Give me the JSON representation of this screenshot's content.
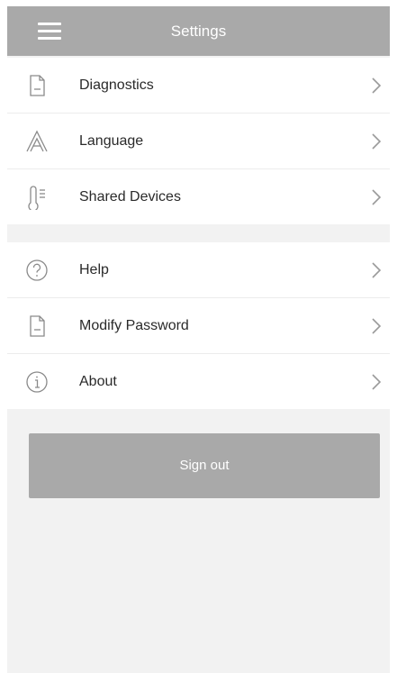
{
  "header": {
    "title": "Settings"
  },
  "sections": [
    {
      "items": [
        {
          "label": "Diagnostics",
          "icon": "document-icon"
        },
        {
          "label": "Language",
          "icon": "font-a-icon"
        },
        {
          "label": "Shared Devices",
          "icon": "thermometer-icon"
        }
      ]
    },
    {
      "items": [
        {
          "label": "Help",
          "icon": "help-circle-icon"
        },
        {
          "label": "Modify Password",
          "icon": "document-icon"
        },
        {
          "label": "About",
          "icon": "info-circle-icon"
        }
      ]
    }
  ],
  "footer": {
    "signout_label": "Sign out"
  },
  "colors": {
    "header_bg": "#a9a9a9",
    "page_bg": "#f2f2f2",
    "row_bg": "#ffffff",
    "icon_stroke": "#8a8a8a"
  }
}
